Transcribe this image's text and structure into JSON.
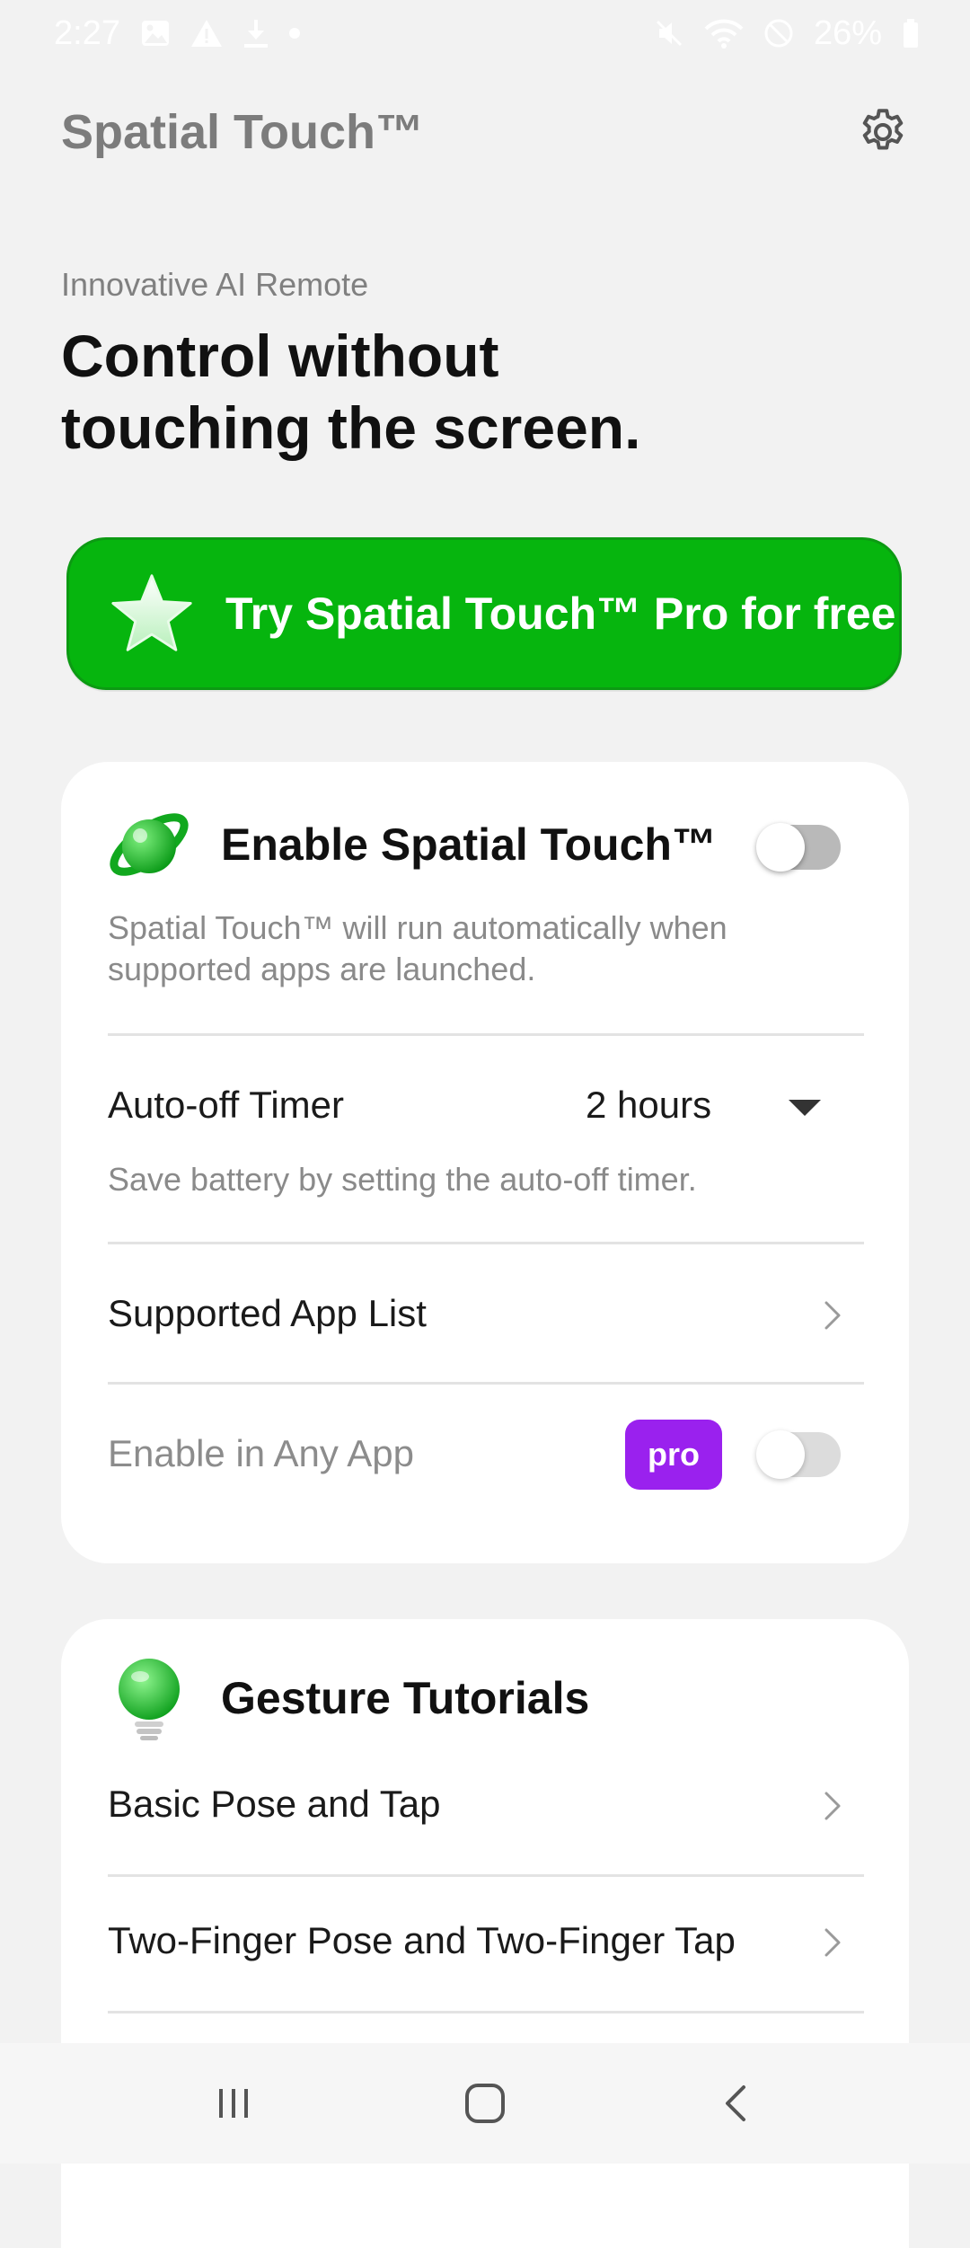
{
  "status_bar": {
    "time": "2:27",
    "battery": "26%",
    "left_icons": [
      "image-icon",
      "warning-icon",
      "download-icon",
      "dot-icon"
    ],
    "right_icons": [
      "mute-icon",
      "wifi-icon",
      "do-not-disturb-icon",
      "battery-icon"
    ]
  },
  "header": {
    "title": "Spatial Touch™",
    "settings_icon": "gear-icon"
  },
  "hero": {
    "subtitle": "Innovative AI Remote",
    "title_line1": "Control without",
    "title_line2": "touching the screen."
  },
  "promo": {
    "label": "Try Spatial Touch™ Pro for free",
    "icon": "star-icon",
    "color": "#06b50e"
  },
  "enable_card": {
    "title": "Enable Spatial Touch™",
    "icon": "spatial-touch-logo-icon",
    "toggle_on": false,
    "description": "Spatial Touch™ will run automatically when supported apps are launched.",
    "timer": {
      "label": "Auto-off Timer",
      "value": "2 hours",
      "description": "Save battery by setting the auto-off timer."
    },
    "supported_apps_label": "Supported App List",
    "any_app": {
      "label": "Enable in Any App",
      "badge": "pro",
      "badge_color": "#9a21ee",
      "toggle_on": false
    }
  },
  "tutorial_card": {
    "title": "Gesture Tutorials",
    "icon": "lightbulb-icon",
    "items": [
      "Basic Pose and Tap",
      "Two-Finger Pose and Two-Finger Tap"
    ]
  },
  "nav_bar": {
    "buttons": [
      "recent-apps-icon",
      "home-icon",
      "back-icon"
    ]
  }
}
